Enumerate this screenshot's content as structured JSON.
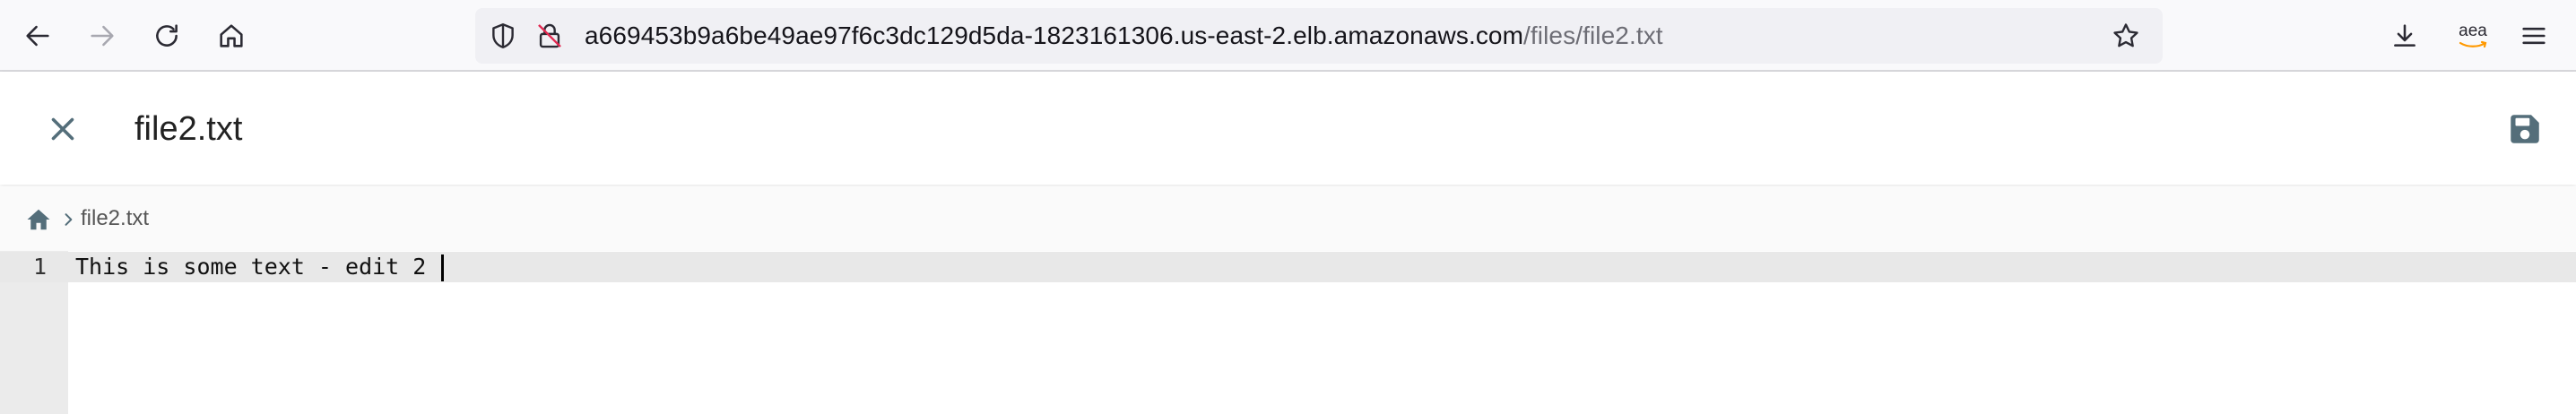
{
  "browser": {
    "url_host": "a669453b9a6be49ae97f6c3dc129d5da-1823161306.us-east-2.elb.amazonaws.com",
    "url_path": "/files/file2.txt",
    "extension_label": "aea",
    "icons": [
      "back-arrow-icon",
      "forward-arrow-icon",
      "reload-icon",
      "home-icon",
      "shield-icon",
      "lock-icon",
      "star-icon",
      "download-icon",
      "amazon-extension-icon",
      "menu-icon"
    ],
    "colors": {
      "toolbar_bg": "#f9f9fb",
      "urlbar_bg": "#f0f0f4",
      "path_text": "#6d6d75",
      "amazon_orange": "#ff9900"
    }
  },
  "app": {
    "file_title": "file2.txt",
    "icons": [
      "close-icon",
      "save-icon"
    ]
  },
  "breadcrumb": {
    "items": [
      {
        "icon": "home-icon"
      },
      {
        "label": "file2.txt"
      }
    ]
  },
  "editor": {
    "lines": [
      {
        "number": "1",
        "text": "This is some text - edit 2 "
      }
    ]
  }
}
